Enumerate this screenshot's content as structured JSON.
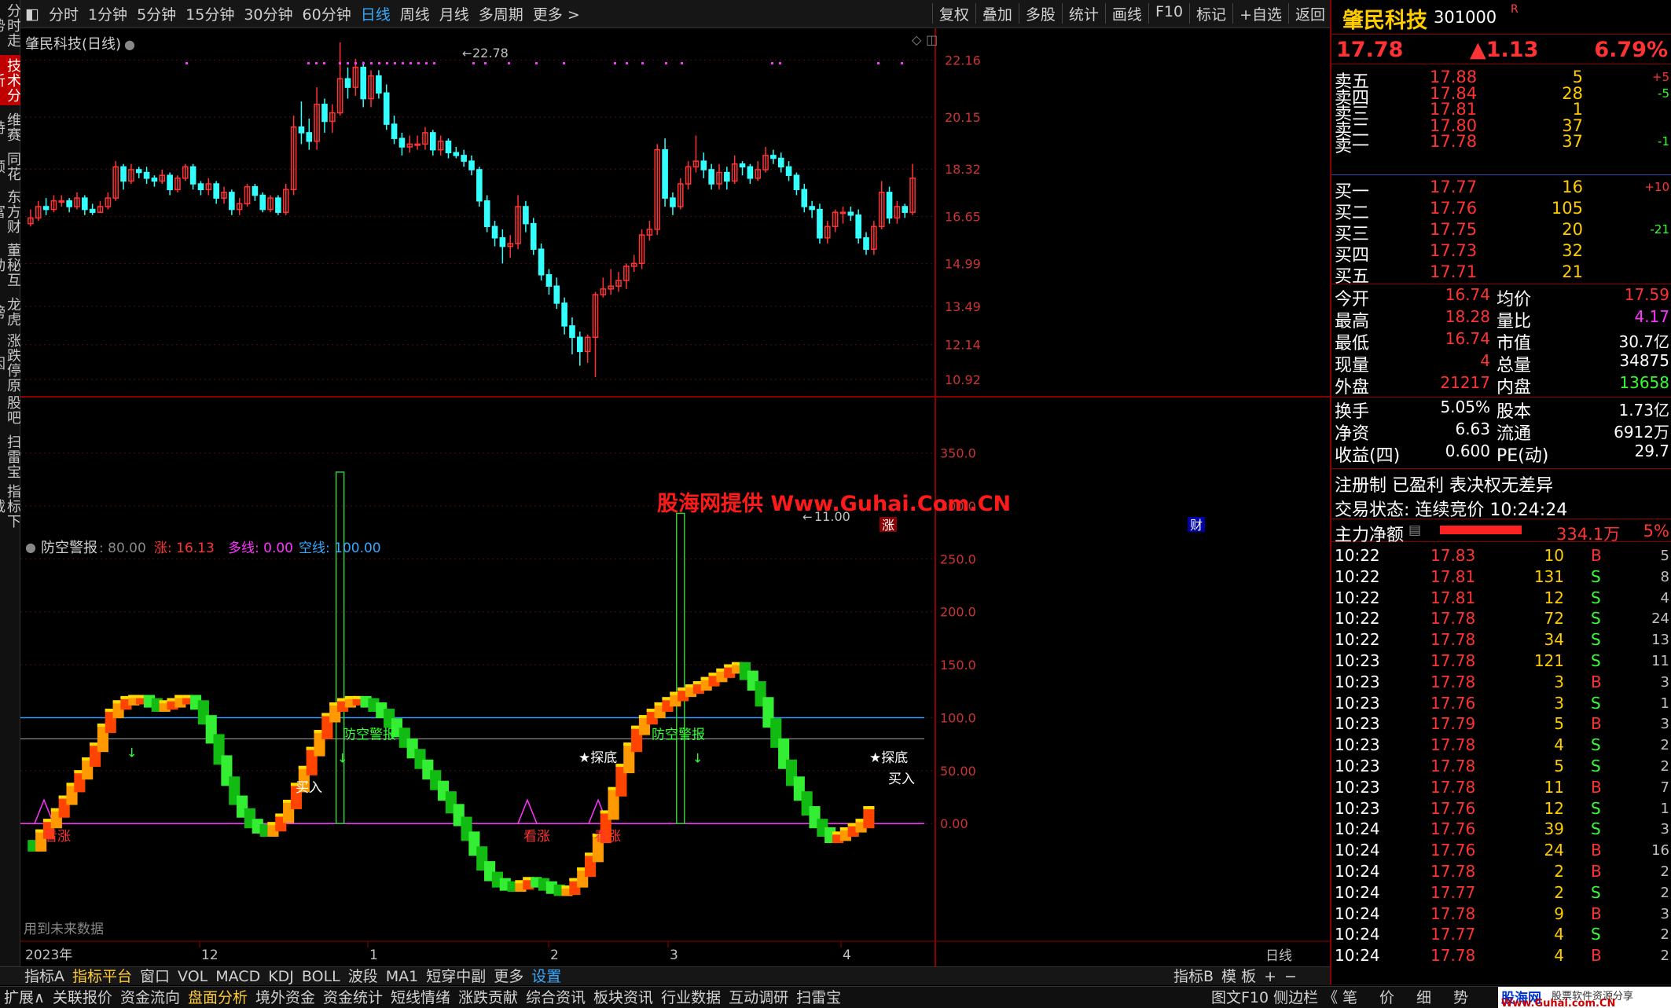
{
  "toolbar": {
    "periods": [
      "分时",
      "1分钟",
      "5分钟",
      "15分钟",
      "30分钟",
      "60分钟",
      "日线",
      "周线",
      "月线",
      "多周期",
      "更多 >"
    ],
    "active": "日线",
    "actions": [
      "复权",
      "叠加",
      "多股",
      "统计",
      "画线",
      "F10",
      "标记",
      "+自选",
      "返回"
    ]
  },
  "leftnav": [
    "分时走势",
    "技术分析",
    "维赛特",
    "同花顺",
    "东方财富",
    "董秘互动",
    "龙虎榜",
    "涨跌停原因",
    "股吧",
    "扫雷宝",
    "指标下载"
  ],
  "leftnav_active": "技术分析",
  "main_panel": {
    "title": "肇民科技(日线)",
    "y_ticks": [
      "22.16",
      "20.15",
      "18.32",
      "16.65",
      "14.99",
      "13.49",
      "12.14",
      "10.92"
    ],
    "high_mark": "22.78",
    "low_mark": "11.00",
    "watermark": "股海网提供 Www.Guhai.Com.CN",
    "tag_zhang": "涨",
    "tag_cai": "财"
  },
  "indicator_panel": {
    "title": "防空警报",
    "value": ": 80.00",
    "zhang_label": "涨: 16.13",
    "duo_label": "多线: 0.00",
    "kong_label": "空线: 100.00",
    "y_ticks": [
      "350.0",
      "300.0",
      "250.0",
      "200.0",
      "150.0",
      "100.0",
      "50.00",
      "0.00"
    ],
    "labels": [
      "看涨",
      "买入",
      "防空警报",
      "看涨",
      "看涨",
      "★探底",
      "防空警报",
      "★探底",
      "买入"
    ],
    "footnote": "用到未来数据",
    "year": "2023年",
    "months": [
      "12",
      "1",
      "2",
      "3",
      "4"
    ],
    "period_label": "日线"
  },
  "indicator_tabs": [
    "指标A",
    "指标平台",
    "窗口",
    "VOL",
    "MACD",
    "KDJ",
    "BOLL",
    "波段",
    "MA1",
    "短穿中副",
    "更多",
    "设置"
  ],
  "indicator_tabs_right": [
    "指标B",
    "模 板",
    "+",
    "−"
  ],
  "bottom_tabs": [
    "扩展∧",
    "关联报价",
    "资金流向",
    "盘面分析",
    "境外资金",
    "资金统计",
    "短线情绪",
    "涨跌贡献",
    "综合资讯",
    "板块资讯",
    "行业数据",
    "互动调研",
    "扫雷宝"
  ],
  "bottom_right": "图文F10 侧边栏 《",
  "bottom_right_tabs": [
    "笔",
    "价",
    "细",
    "势"
  ],
  "brand": {
    "name": "股海网",
    "slogan": "股票软件资源分享",
    "url": "Www.Guhai.com.CN"
  },
  "quote": {
    "name": "肇民科技",
    "code": "301000",
    "flag": "R",
    "price": "17.78",
    "change": "▲1.13",
    "pct": "6.79%",
    "sells": [
      {
        "label": "卖五",
        "price": "17.88",
        "vol": "5",
        "chg": "+5"
      },
      {
        "label": "卖四",
        "price": "17.84",
        "vol": "28",
        "chg": "-5"
      },
      {
        "label": "卖三",
        "price": "17.81",
        "vol": "1",
        "chg": ""
      },
      {
        "label": "卖二",
        "price": "17.80",
        "vol": "37",
        "chg": ""
      },
      {
        "label": "卖一",
        "price": "17.78",
        "vol": "37",
        "chg": "-1"
      }
    ],
    "buys": [
      {
        "label": "买一",
        "price": "17.77",
        "vol": "16",
        "chg": "+10"
      },
      {
        "label": "买二",
        "price": "17.76",
        "vol": "105",
        "chg": ""
      },
      {
        "label": "买三",
        "price": "17.75",
        "vol": "20",
        "chg": "-21"
      },
      {
        "label": "买四",
        "price": "17.73",
        "vol": "32",
        "chg": ""
      },
      {
        "label": "买五",
        "price": "17.71",
        "vol": "21",
        "chg": ""
      }
    ],
    "stats": [
      {
        "l1": "今开",
        "v1": "16.74",
        "l2": "均价",
        "v2": "17.59"
      },
      {
        "l1": "最高",
        "v1": "18.28",
        "l2": "量比",
        "v2": "4.17"
      },
      {
        "l1": "最低",
        "v1": "16.74",
        "l2": "市值",
        "v2": "30.7亿"
      },
      {
        "l1": "现量",
        "v1": "4",
        "l2": "总量",
        "v2": "34875"
      },
      {
        "l1": "外盘",
        "v1": "21217",
        "l2": "内盘",
        "v2": "13658"
      },
      {
        "l1": "换手",
        "v1": "5.05%",
        "l2": "股本",
        "v2": "1.73亿"
      },
      {
        "l1": "净资",
        "v1": "6.63",
        "l2": "流通",
        "v2": "6912万"
      },
      {
        "l1": "收益(四)",
        "v1": "0.600",
        "l2": "PE(动)",
        "v2": "29.7"
      }
    ],
    "reg": "注册制 已盈利 表决权无差异",
    "status": "交易状态: 连续竞价 10:24:24",
    "main_net_label": "主力净额",
    "main_net_value": "334.1万",
    "main_net_pct": "5%",
    "ticks": [
      [
        "10:22",
        "17.83",
        "10",
        "B",
        "5"
      ],
      [
        "10:22",
        "17.81",
        "131",
        "S",
        "8"
      ],
      [
        "10:22",
        "17.81",
        "12",
        "S",
        "4"
      ],
      [
        "10:22",
        "17.78",
        "72",
        "S",
        "24"
      ],
      [
        "10:22",
        "17.78",
        "34",
        "S",
        "13"
      ],
      [
        "10:23",
        "17.78",
        "121",
        "S",
        "11"
      ],
      [
        "10:23",
        "17.78",
        "3",
        "B",
        "3"
      ],
      [
        "10:23",
        "17.76",
        "3",
        "S",
        "1"
      ],
      [
        "10:23",
        "17.79",
        "5",
        "B",
        "3"
      ],
      [
        "10:23",
        "17.78",
        "4",
        "S",
        "2"
      ],
      [
        "10:23",
        "17.78",
        "5",
        "S",
        "2"
      ],
      [
        "10:23",
        "17.78",
        "11",
        "B",
        "7"
      ],
      [
        "10:23",
        "17.76",
        "12",
        "S",
        "1"
      ],
      [
        "10:24",
        "17.76",
        "39",
        "S",
        "3"
      ],
      [
        "10:24",
        "17.76",
        "24",
        "B",
        "16"
      ],
      [
        "10:24",
        "17.78",
        "2",
        "B",
        "2"
      ],
      [
        "10:24",
        "17.77",
        "2",
        "S",
        "2"
      ],
      [
        "10:24",
        "17.78",
        "9",
        "B",
        "3"
      ],
      [
        "10:24",
        "17.77",
        "4",
        "S",
        "2"
      ],
      [
        "10:24",
        "17.78",
        "4",
        "B",
        "2"
      ]
    ]
  },
  "chart_data": {
    "type": "candlestick",
    "price_axis": [
      10.92,
      22.16
    ],
    "candles": [
      [
        16.4,
        16.6,
        16.9,
        16.3
      ],
      [
        16.6,
        17.0,
        17.2,
        16.5
      ],
      [
        17.0,
        16.9,
        17.3,
        16.7
      ],
      [
        16.9,
        17.2,
        17.4,
        16.8
      ],
      [
        17.2,
        17.2,
        17.4,
        17.0
      ],
      [
        17.2,
        17.0,
        17.3,
        16.8
      ],
      [
        17.0,
        17.3,
        17.5,
        16.9
      ],
      [
        17.3,
        16.9,
        17.4,
        16.7
      ],
      [
        16.9,
        16.8,
        17.1,
        16.7
      ],
      [
        16.8,
        17.0,
        17.2,
        16.8
      ],
      [
        17.0,
        17.3,
        17.5,
        16.9
      ],
      [
        17.3,
        18.4,
        18.6,
        17.2
      ],
      [
        18.4,
        17.9,
        18.5,
        17.6
      ],
      [
        17.9,
        18.3,
        18.5,
        17.8
      ],
      [
        18.3,
        18.2,
        18.4,
        18.0
      ],
      [
        18.2,
        18.0,
        18.4,
        17.8
      ],
      [
        18.0,
        17.9,
        18.1,
        17.7
      ],
      [
        17.9,
        18.1,
        18.3,
        17.8
      ],
      [
        18.1,
        17.6,
        18.2,
        17.4
      ],
      [
        17.6,
        18.0,
        18.1,
        17.5
      ],
      [
        18.0,
        18.4,
        18.5,
        17.9
      ],
      [
        18.4,
        17.8,
        18.5,
        17.6
      ],
      [
        17.8,
        17.6,
        17.9,
        17.4
      ],
      [
        17.6,
        17.8,
        18.0,
        17.4
      ],
      [
        17.8,
        17.3,
        17.9,
        17.1
      ],
      [
        17.3,
        17.5,
        17.7,
        17.1
      ],
      [
        17.5,
        16.9,
        17.6,
        16.7
      ],
      [
        16.9,
        17.1,
        17.3,
        16.7
      ],
      [
        17.1,
        17.7,
        17.8,
        17.0
      ],
      [
        17.7,
        17.4,
        17.8,
        17.2
      ],
      [
        17.4,
        16.9,
        17.5,
        16.8
      ],
      [
        16.9,
        17.3,
        17.4,
        16.8
      ],
      [
        17.3,
        16.8,
        17.4,
        16.7
      ],
      [
        16.8,
        17.6,
        17.8,
        16.7
      ],
      [
        17.6,
        19.8,
        20.2,
        17.4
      ],
      [
        19.8,
        19.6,
        20.7,
        19.2
      ],
      [
        19.6,
        19.3,
        20.1,
        19.0
      ],
      [
        19.3,
        20.6,
        21.2,
        19.0
      ],
      [
        20.6,
        20.0,
        20.8,
        19.6
      ],
      [
        20.0,
        20.3,
        20.6,
        19.6
      ],
      [
        20.3,
        21.5,
        22.78,
        20.2
      ],
      [
        21.5,
        21.2,
        21.9,
        20.8
      ],
      [
        21.2,
        21.9,
        22.2,
        20.9
      ],
      [
        21.9,
        20.8,
        22.1,
        20.5
      ],
      [
        20.8,
        21.6,
        21.8,
        20.5
      ],
      [
        21.6,
        21.0,
        21.8,
        20.8
      ],
      [
        21.0,
        19.9,
        21.3,
        19.7
      ],
      [
        19.9,
        19.4,
        20.2,
        19.2
      ],
      [
        19.4,
        19.1,
        19.6,
        18.8
      ],
      [
        19.1,
        19.2,
        19.5,
        18.9
      ],
      [
        19.2,
        19.2,
        19.5,
        19.0
      ],
      [
        19.2,
        19.6,
        19.8,
        19.0
      ],
      [
        19.6,
        19.0,
        19.7,
        18.8
      ],
      [
        19.0,
        19.3,
        19.5,
        18.8
      ],
      [
        19.3,
        18.9,
        19.4,
        18.7
      ],
      [
        18.9,
        18.8,
        19.1,
        18.7
      ],
      [
        18.8,
        18.6,
        19.0,
        18.4
      ],
      [
        18.6,
        18.3,
        18.8,
        18.1
      ],
      [
        18.3,
        17.2,
        18.4,
        17.0
      ],
      [
        17.2,
        16.3,
        17.4,
        16.1
      ],
      [
        16.3,
        15.9,
        16.5,
        15.6
      ],
      [
        15.9,
        15.6,
        16.2,
        15.0
      ],
      [
        15.6,
        15.7,
        16.0,
        15.2
      ],
      [
        15.7,
        17.0,
        17.4,
        15.5
      ],
      [
        17.0,
        16.4,
        17.2,
        16.1
      ],
      [
        16.4,
        15.5,
        16.6,
        15.3
      ],
      [
        15.5,
        14.6,
        15.7,
        14.4
      ],
      [
        14.6,
        14.2,
        14.8,
        13.9
      ],
      [
        14.2,
        13.6,
        14.5,
        13.4
      ],
      [
        13.6,
        12.8,
        13.8,
        12.5
      ],
      [
        12.8,
        12.4,
        13.1,
        11.8
      ],
      [
        12.4,
        11.9,
        12.6,
        11.4
      ],
      [
        11.9,
        12.4,
        12.5,
        11.5
      ],
      [
        12.4,
        13.9,
        14.0,
        11.0
      ],
      [
        13.9,
        14.1,
        14.5,
        13.8
      ],
      [
        14.1,
        14.2,
        14.8,
        13.9
      ],
      [
        14.2,
        14.4,
        14.7,
        14.0
      ],
      [
        14.4,
        14.9,
        15.0,
        14.1
      ],
      [
        14.9,
        15.0,
        15.3,
        14.7
      ],
      [
        15.0,
        16.0,
        16.2,
        14.8
      ],
      [
        16.0,
        16.2,
        16.5,
        15.8
      ],
      [
        16.2,
        19.0,
        19.2,
        16.0
      ],
      [
        19.0,
        17.3,
        19.4,
        17.0
      ],
      [
        17.3,
        17.0,
        17.5,
        16.7
      ],
      [
        17.0,
        17.8,
        18.0,
        16.9
      ],
      [
        17.8,
        18.4,
        18.6,
        17.6
      ],
      [
        18.4,
        18.6,
        19.5,
        18.2
      ],
      [
        18.6,
        18.3,
        18.9,
        18.0
      ],
      [
        18.3,
        17.8,
        18.5,
        17.6
      ],
      [
        17.8,
        18.2,
        18.5,
        17.6
      ],
      [
        18.2,
        17.9,
        18.4,
        17.6
      ],
      [
        17.9,
        18.5,
        18.8,
        17.8
      ],
      [
        18.5,
        18.4,
        18.6,
        18.1
      ],
      [
        18.4,
        18.0,
        18.5,
        17.8
      ],
      [
        18.0,
        18.3,
        18.6,
        17.9
      ],
      [
        18.3,
        18.8,
        19.1,
        18.2
      ],
      [
        18.8,
        18.7,
        19.0,
        18.5
      ],
      [
        18.7,
        18.4,
        18.9,
        18.2
      ],
      [
        18.4,
        18.1,
        18.6,
        17.9
      ],
      [
        18.1,
        17.6,
        18.2,
        17.4
      ],
      [
        17.6,
        17.0,
        17.8,
        16.8
      ],
      [
        17.0,
        16.9,
        17.2,
        16.6
      ],
      [
        16.9,
        15.9,
        17.1,
        15.7
      ],
      [
        15.9,
        16.3,
        16.5,
        15.7
      ],
      [
        16.3,
        16.8,
        16.9,
        16.1
      ],
      [
        16.8,
        16.8,
        17.0,
        16.4
      ],
      [
        16.8,
        16.7,
        17.0,
        16.5
      ],
      [
        16.7,
        15.9,
        16.9,
        15.7
      ],
      [
        15.9,
        15.5,
        16.1,
        15.3
      ],
      [
        15.5,
        16.3,
        16.5,
        15.3
      ],
      [
        16.3,
        17.5,
        17.9,
        16.2
      ],
      [
        17.5,
        16.6,
        17.7,
        16.4
      ],
      [
        16.6,
        17.0,
        17.2,
        16.4
      ],
      [
        17.0,
        16.8,
        17.1,
        16.6
      ],
      [
        16.8,
        18.0,
        18.5,
        16.7
      ]
    ],
    "indicator_axis": [
      -70,
      380
    ],
    "indicator_line": [
      -20,
      -22,
      -10,
      0,
      10,
      22,
      34,
      46,
      58,
      72,
      90,
      104,
      112,
      116,
      117,
      117,
      114,
      110,
      112,
      114,
      117,
      117,
      112,
      98,
      80,
      60,
      40,
      22,
      10,
      0,
      -5,
      -8,
      -3,
      5,
      18,
      34,
      50,
      68,
      84,
      100,
      110,
      114,
      116,
      116,
      114,
      110,
      104,
      95,
      86,
      76,
      66,
      56,
      46,
      36,
      26,
      14,
      2,
      -12,
      -26,
      -40,
      -50,
      -56,
      -59,
      -60,
      -58,
      -55,
      -56,
      -59,
      -62,
      -64,
      -63,
      -56,
      -46,
      -32,
      -14,
      8,
      30,
      52,
      72,
      88,
      98,
      104,
      110,
      115,
      120,
      124,
      127,
      130,
      134,
      138,
      142,
      146,
      148,
      140,
      130,
      115,
      95,
      76,
      56,
      40,
      26,
      12,
      0,
      -8,
      -14,
      -12,
      -8,
      -4,
      0,
      12
    ],
    "alarm_bars": [
      {
        "i": 40,
        "h": 332
      },
      {
        "i": 84,
        "h": 293
      }
    ],
    "reference_lines": {
      "duo": 0.0,
      "kong": 100.0,
      "mid": 80.0
    }
  }
}
